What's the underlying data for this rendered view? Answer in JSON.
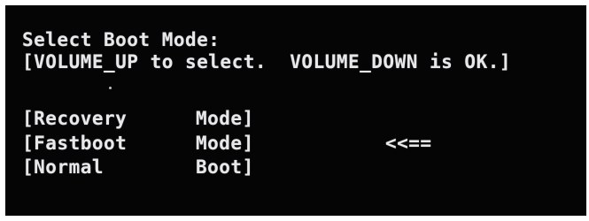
{
  "screen": {
    "title": "Select Boot Mode:",
    "instructions": "[VOLUME_UP to select.  VOLUME_DOWN is OK.]",
    "options": [
      {
        "name": "[Recovery",
        "type": "Mode]"
      },
      {
        "name": "[Fastboot",
        "type": "Mode]"
      },
      {
        "name": "[Normal",
        "type": "Boot]"
      }
    ],
    "selection_indicator": "<<==",
    "selected_index": 1,
    "colors": {
      "background": "#050505",
      "text": "#e8e8ea"
    }
  }
}
